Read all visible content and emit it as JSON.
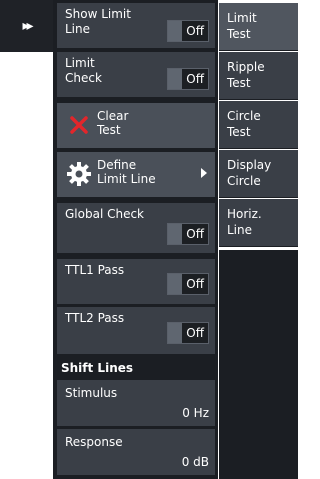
{
  "sidebar": {
    "expand_icon": "double-chevron-right-icon",
    "expand_glyph": "▸▸"
  },
  "left": {
    "show_limit_line": {
      "label": "Show Limit\nLine",
      "value": "Off"
    },
    "limit_check": {
      "label": "Limit\nCheck",
      "value": "Off"
    },
    "clear_test": {
      "label": "Clear\nTest",
      "icon": "red-x-icon"
    },
    "define_limit_line": {
      "label": "Define\nLimit Line",
      "icon": "gear-icon"
    },
    "global_check": {
      "label": "Global Check",
      "value": "Off"
    },
    "ttl1_pass": {
      "label": "TTL1 Pass",
      "value": "Off"
    },
    "ttl2_pass": {
      "label": "TTL2 Pass",
      "value": "Off"
    },
    "shift_lines_heading": "Shift Lines",
    "stimulus": {
      "label": "Stimulus",
      "value": "0 Hz"
    },
    "response": {
      "label": "Response",
      "value": "0 dB"
    }
  },
  "right_tabs": [
    {
      "label": "Limit\nTest"
    },
    {
      "label": "Ripple\nTest"
    },
    {
      "label": "Circle\nTest"
    },
    {
      "label": "Display\nCircle"
    },
    {
      "label": "Horiz.\nLine"
    }
  ],
  "colors": {
    "accent_red": "#e3262b",
    "panel": "#1b1e23",
    "tile": "#3a3f47"
  }
}
